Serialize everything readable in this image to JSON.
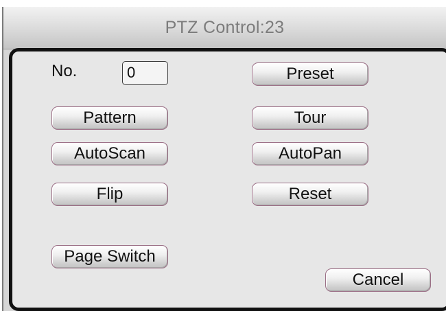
{
  "window": {
    "title": "PTZ Control:23"
  },
  "preset_number": {
    "label": "No.",
    "value": "0"
  },
  "buttons": {
    "preset": "Preset",
    "pattern": "Pattern",
    "tour": "Tour",
    "autoscan": "AutoScan",
    "autopan": "AutoPan",
    "flip": "Flip",
    "reset": "Reset",
    "page_switch": "Page Switch",
    "cancel": "Cancel"
  }
}
